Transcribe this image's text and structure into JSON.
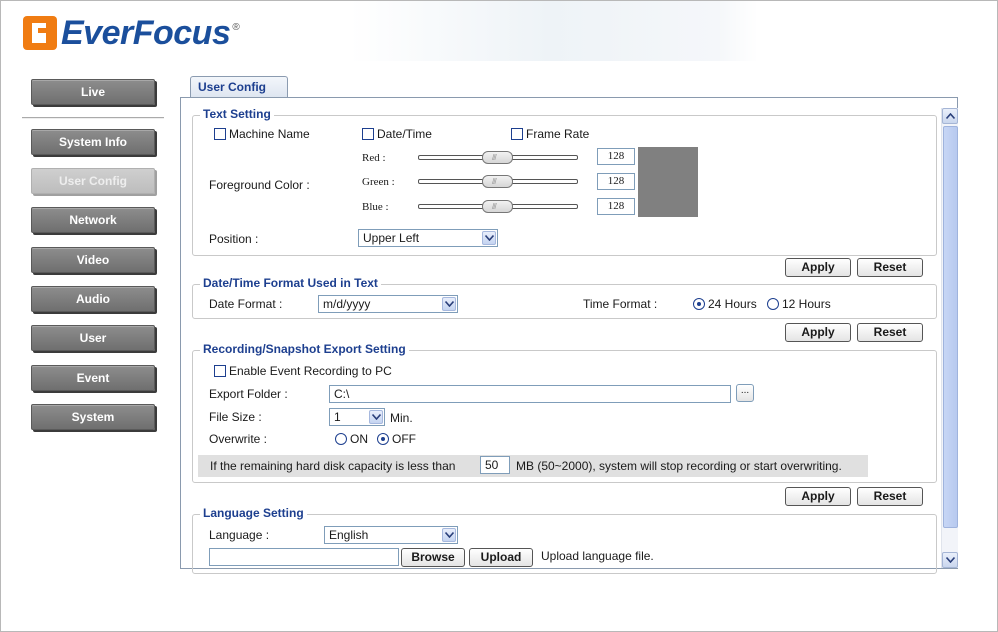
{
  "brand": {
    "logo_text": "EverFocus",
    "logo_reg": "®",
    "accent": "#f07c12",
    "brand_color": "#1b4f9c"
  },
  "nav": {
    "items": [
      {
        "label": "Live"
      },
      {
        "label": "System Info"
      },
      {
        "label": "User Config",
        "active": true
      },
      {
        "label": "Network"
      },
      {
        "label": "Video"
      },
      {
        "label": "Audio"
      },
      {
        "label": "User"
      },
      {
        "label": "Event"
      },
      {
        "label": "System"
      }
    ]
  },
  "tab": {
    "label": "User Config"
  },
  "text_setting": {
    "title": "Text Setting",
    "machine_name": "Machine Name",
    "date_time": "Date/Time",
    "frame_rate": "Frame Rate",
    "foreground_color_label": "Foreground Color :",
    "red_label": "Red :",
    "green_label": "Green :",
    "blue_label": "Blue :",
    "red_value": "128",
    "green_value": "128",
    "blue_value": "128",
    "swatch_color": "#808080",
    "position_label": "Position :",
    "position_value": "Upper Left"
  },
  "buttons": {
    "apply": "Apply",
    "reset": "Reset",
    "browse": "Browse",
    "upload": "Upload",
    "dots": "..."
  },
  "datetime_format": {
    "title": "Date/Time Format Used in Text",
    "date_format_label": "Date Format :",
    "date_format_value": "m/d/yyyy",
    "time_format_label": "Time Format :",
    "hours24": "24 Hours",
    "hours12": "12 Hours",
    "selected": "24 Hours"
  },
  "recording": {
    "title": "Recording/Snapshot Export Setting",
    "enable_label": "Enable Event Recording to PC",
    "export_folder_label": "Export Folder :",
    "export_folder_value": "C:\\",
    "file_size_label": "File Size :",
    "file_size_value": "1",
    "file_size_unit": "Min.",
    "overwrite_label": "Overwrite :",
    "on": "ON",
    "off": "OFF",
    "overwrite_selected": "OFF",
    "warning_prefix": "If the remaining hard disk capacity is less than",
    "warning_value": "50",
    "warning_suffix": "MB (50~2000), system will stop recording or start overwriting."
  },
  "language": {
    "title": "Language Setting",
    "language_label": "Language :",
    "language_value": "English",
    "upload_hint": "Upload language file."
  }
}
